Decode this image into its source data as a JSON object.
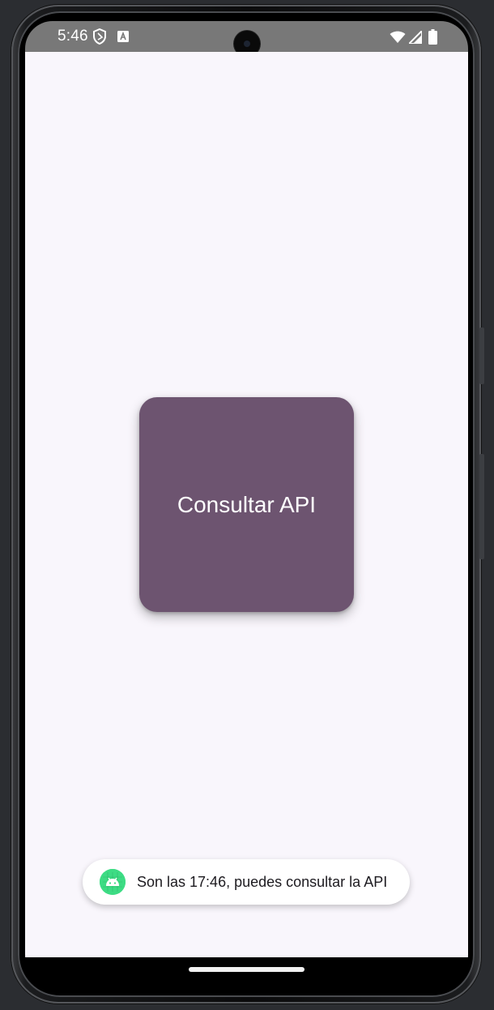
{
  "status_bar": {
    "time": "5:46",
    "left_icons": [
      "shield-icon",
      "keyboard-a-icon"
    ],
    "right_icons": [
      "wifi-icon",
      "cellular-signal-icon",
      "battery-icon"
    ]
  },
  "main": {
    "button_label": "Consultar API"
  },
  "toast": {
    "icon": "android-icon",
    "message": "Son las 17:46, puedes consultar la API"
  },
  "colors": {
    "button_background": "#6d5470",
    "app_background": "#f9f6fc",
    "status_bar": "#787878",
    "toast_icon": "#3ddc84"
  }
}
